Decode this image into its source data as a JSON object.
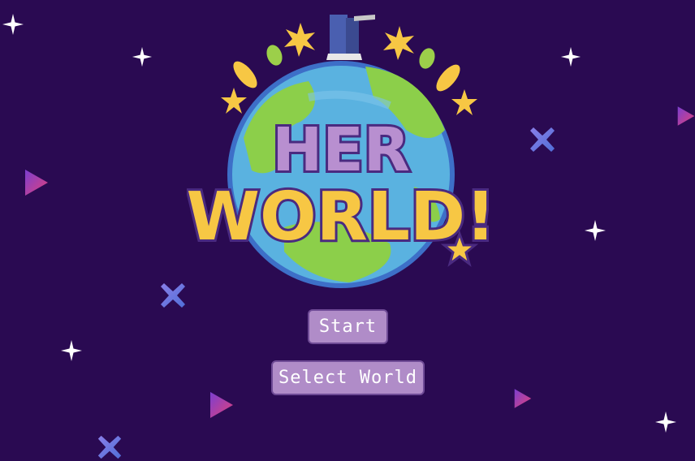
{
  "logo": {
    "line1": "HER",
    "line2": "WORLD!"
  },
  "menu": {
    "start_label": "Start",
    "select_world_label": "Select World"
  },
  "colors": {
    "background": "#2a0a52",
    "button_fill": "#b08cc8",
    "button_border": "#6f4b96",
    "logo_yellow": "#f7c744",
    "logo_purple": "#b88fd0",
    "globe_ocean": "#5ab2e0",
    "globe_land": "#8ccf4a"
  },
  "decorations": {
    "sparkle_icon": "four-point-star",
    "triangle_icon": "play-triangle",
    "cross_icon": "x-mark"
  }
}
